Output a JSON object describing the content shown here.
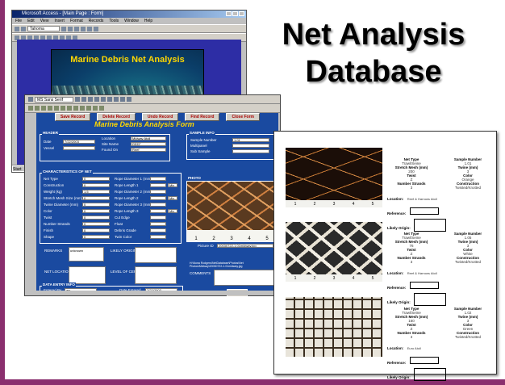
{
  "slide": {
    "title": "Net Analysis Database"
  },
  "access_window": {
    "title": "Microsoft Access - [Main Page : Form]",
    "menu": [
      "File",
      "Edit",
      "View",
      "Insert",
      "Format",
      "Records",
      "Tools",
      "Window",
      "Help"
    ],
    "font_field": "Tahoma",
    "banner_text": "Marine Debris Net Analysis",
    "start_label": "Start"
  },
  "form_window": {
    "font_field": "MS Sans Serif",
    "buttons": [
      "Save Record",
      "Delete Record",
      "Undo Record",
      "Find Record",
      "Close Form"
    ],
    "form_title": "Marine Debris Analysis Form",
    "header": {
      "section": "HEADER",
      "fields": [
        {
          "label": "Date",
          "value": "7/22/2003"
        },
        {
          "label": "Vessel",
          "value": ""
        },
        {
          "label": "Location",
          "value": "Midway Atoll"
        },
        {
          "label": "Site Name",
          "value": "REEF"
        },
        {
          "label": "Found On",
          "value": "Reef"
        }
      ]
    },
    "sample_info": {
      "section": "SAMPLE INFO",
      "fields": [
        {
          "label": "Sample Number",
          "value": "1.01"
        },
        {
          "label": "Multipanel",
          "value": ""
        },
        {
          "label": "Sub Sample",
          "value": ""
        }
      ]
    },
    "characteristics": {
      "section": "CHARACTERISTICS OF NET",
      "left": [
        "Net Type",
        "Construction",
        "Weight (kg)",
        "Stretch Mesh Size (mm)",
        "Twine Diameter (mm)",
        "Color",
        "Twist",
        "Number Strands",
        "Finish",
        "Shape"
      ],
      "left_values": [
        "0",
        "0",
        "1.5",
        "0",
        "0",
        "0",
        "0",
        "0",
        "0",
        "0"
      ],
      "right": [
        "Rope Diameter 1 (mm)",
        "Rope Length 1",
        "Rope Diameter 2 (mm)",
        "Rope Length 2",
        "Rope Diameter 3 (mm)",
        "Rope Length 3",
        "Cut Edge",
        "Float",
        "Debris Grade",
        "Twin Color"
      ],
      "right_values": [
        "",
        "",
        "",
        "",
        "",
        "",
        "",
        "",
        "",
        ""
      ],
      "units": [
        "Mix",
        "Mix",
        "Mix"
      ]
    },
    "photo": {
      "section": "PHOTO",
      "ruler": [
        "1",
        "2",
        "3",
        "4",
        "5"
      ],
      "file_label": "Picture ID",
      "file_value": "20030722-1.01midway.jpg"
    },
    "notes": [
      {
        "label": "REMARKS",
        "value": "unknown"
      },
      {
        "label": "LIKELY ORIGIN",
        "value": ""
      },
      {
        "label": "NET LOCATION",
        "value": ""
      },
      {
        "label": "LEVEL OF CERTAINTY",
        "value": ""
      },
      {
        "label": "COMMENTS",
        "value": ""
      }
    ],
    "photo_caption": "H:\\Nona Rodgers\\NetDatabase\\Photos\\Net Photos\\Midway\\20030722-1.01midway.jpg",
    "data_entry": {
      "section": "DATA ENTRY INFO",
      "entered_by_label": "Entered By",
      "entered_by_value": "aw",
      "date_entered_label": "Date Entered",
      "date_entered_value": "7/22/2003"
    },
    "edit_button": "Edit Pic"
  },
  "report": {
    "entries": [
      {
        "net_type": "Trawl/Seine",
        "sample_number": "1.01",
        "stretch": "200",
        "twine": "3",
        "twist": "Z",
        "color": "Orange",
        "strands": "3",
        "construction": "Twisted/Knotted",
        "location": "Reef & Harrows Atoll",
        "ruler": [
          "1",
          "2",
          "3",
          "4",
          "5"
        ]
      },
      {
        "net_type": "Trawl/Seine",
        "sample_number": "1.05",
        "stretch": "76",
        "twine": "3",
        "twist": "Z",
        "color": "White",
        "strands": "3",
        "construction": "Twisted/Knotted",
        "location": "Reef & Harrows Atoll",
        "ruler": [
          "1",
          "2",
          "3",
          "4",
          "5"
        ]
      },
      {
        "net_type": "Trawl/Seine",
        "sample_number": "1.02",
        "stretch": "160",
        "twine": "3",
        "twist": "Z",
        "color": "Green",
        "strands": "3",
        "construction": "Twisted/Knotted",
        "location": "Euro Atoll",
        "ruler": []
      }
    ],
    "labels": {
      "net_type": "Net Type",
      "sample_number": "Sample Number",
      "stretch": "Stretch Mesh (mm)",
      "twine": "Twine (mm)",
      "twist": "Twist",
      "color": "Color",
      "strands": "Number Strands",
      "construction": "Construction",
      "location": "Location:",
      "reference": "Reference:",
      "origin": "Likely Origin:"
    }
  }
}
